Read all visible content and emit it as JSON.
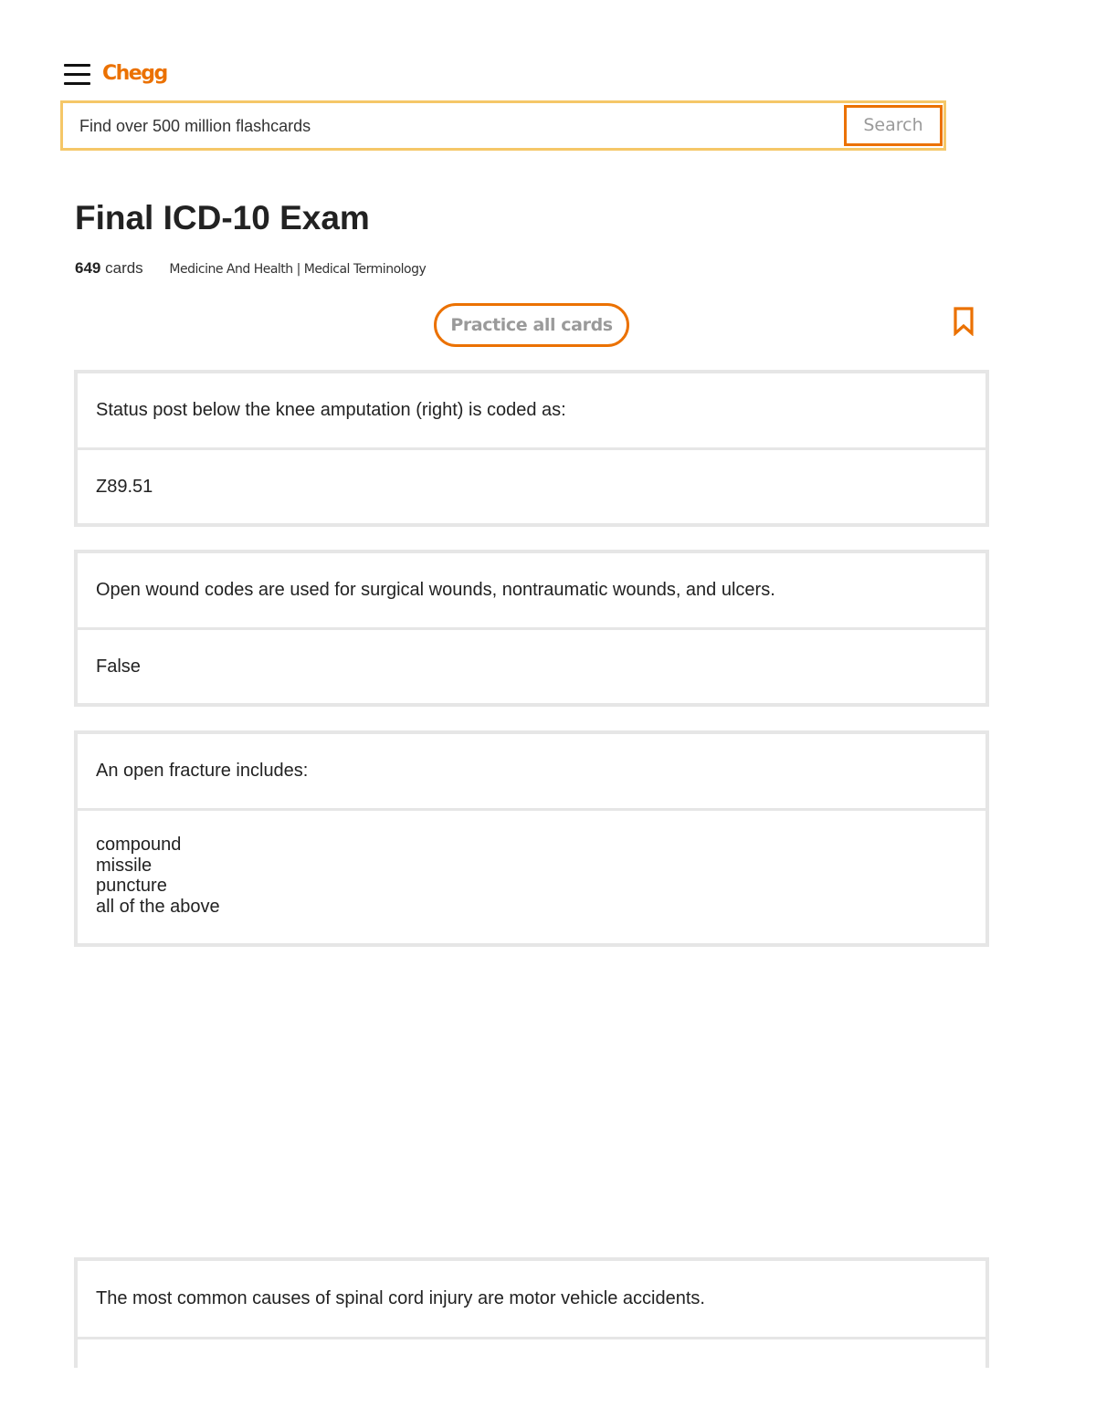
{
  "header": {
    "logo": "Chegg",
    "menu_icon": "hamburger-menu-icon"
  },
  "search": {
    "placeholder": "Find over 500 million flashcards",
    "button_label": "Search"
  },
  "deck": {
    "title": "Final ICD-10 Exam",
    "card_count": "649",
    "cards_label": "cards",
    "category": "Medicine And Health | Medical Terminology",
    "practice_label": "Practice all cards",
    "bookmark_icon": "bookmark-icon"
  },
  "cards": [
    {
      "question": "Status post below the knee amputation (right) is coded as:",
      "answer": [
        "Z89.51"
      ]
    },
    {
      "question": "Open wound codes are used for surgical wounds, nontraumatic wounds, and ulcers.",
      "answer": [
        "False"
      ]
    },
    {
      "question": "An open fracture includes:",
      "answer": [
        "compound",
        "missile",
        "puncture",
        "all of the above"
      ]
    },
    {
      "question": "The most common causes of spinal cord injury are motor vehicle accidents.",
      "answer": []
    }
  ],
  "colors": {
    "brand": "#eb7100",
    "search_border": "#f5c768",
    "card_border": "#e6e6e6",
    "button_text": "#9a9a9a"
  }
}
